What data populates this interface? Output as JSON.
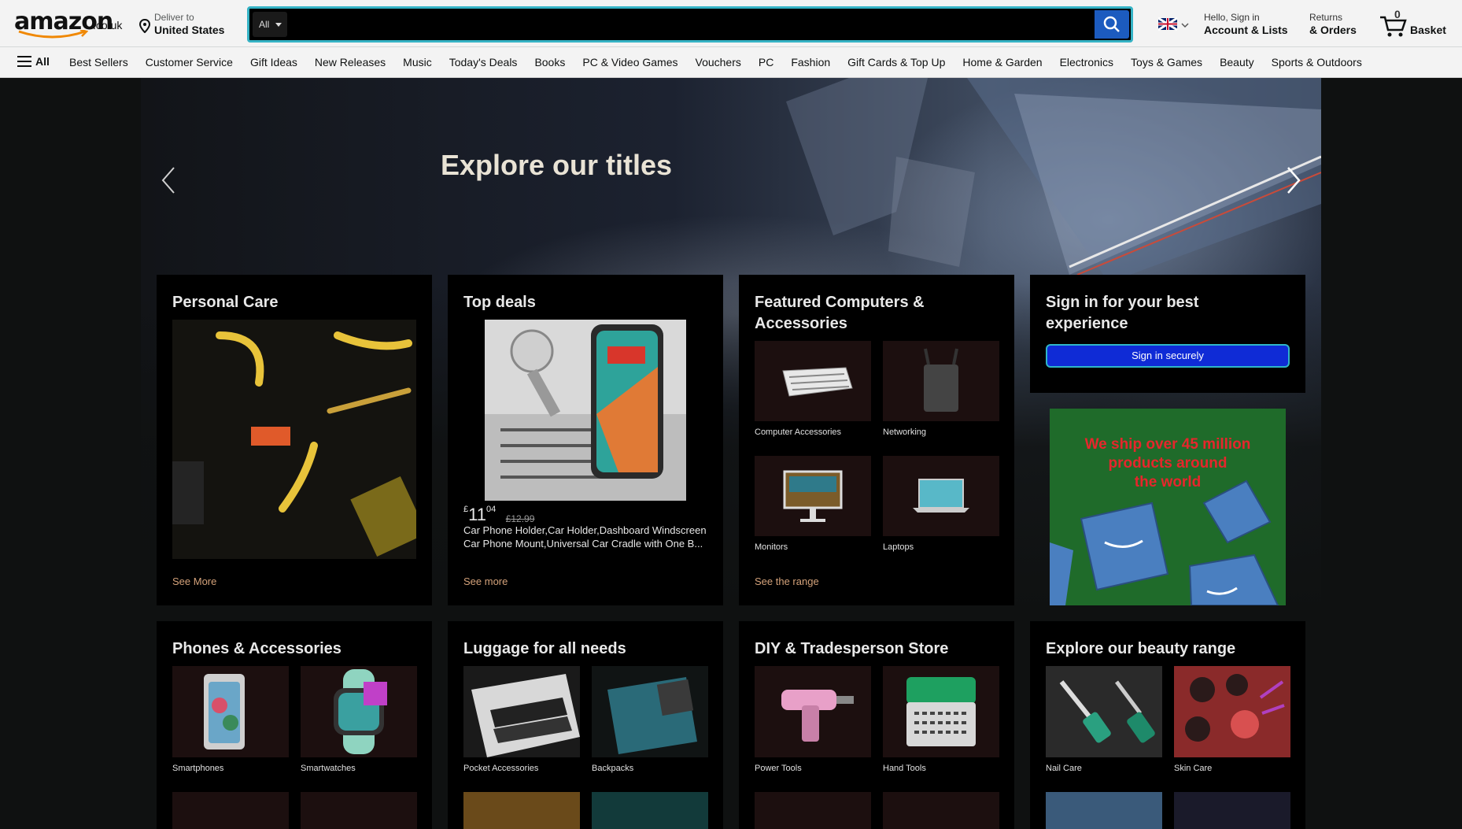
{
  "header": {
    "logo_word": "amazon",
    "logo_tld": ".co.uk",
    "deliver_to": "Deliver to",
    "deliver_location": "United States",
    "search_category": "All",
    "search_placeholder": "",
    "account_greeting": "Hello, Sign in",
    "account_label": "Account & Lists",
    "returns_l1": "Returns",
    "returns_l2": "& Orders",
    "basket_count": "0",
    "basket_label": "Basket"
  },
  "subnav": {
    "all_label": "All",
    "items": [
      "Best Sellers",
      "Customer Service",
      "Gift Ideas",
      "New Releases",
      "Music",
      "Today's Deals",
      "Books",
      "PC & Video Games",
      "Vouchers",
      "PC",
      "Fashion",
      "Gift Cards & Top Up",
      "Home & Garden",
      "Electronics",
      "Toys & Games",
      "Beauty",
      "Sports & Outdoors"
    ]
  },
  "hero": {
    "title": "Explore our titles"
  },
  "cards": {
    "personal_care": {
      "title": "Personal Care",
      "link": "See More"
    },
    "top_deals": {
      "title": "Top deals",
      "price_symbol": "£",
      "price_whole": "11",
      "price_fraction": "04",
      "price_was": "£12.99",
      "product_line1": "Car Phone Holder,Car Holder,Dashboard Windscreen",
      "product_line2": "Car Phone Mount,Universal Car Cradle with One B...",
      "link": "See more"
    },
    "computers": {
      "title_l1": "Featured Computers &",
      "title_l2": "Accessories",
      "tiles": [
        "Computer Accessories",
        "Networking",
        "Monitors",
        "Laptops"
      ],
      "link": "See the range"
    },
    "signin": {
      "title_l1": "Sign in for your best",
      "title_l2": "experience",
      "button": "Sign in securely"
    },
    "ship_ad": {
      "line1": "We ship over 45 million",
      "line2": "products around",
      "line3": "the world"
    },
    "phones": {
      "title": "Phones & Accessories",
      "tiles": [
        "Smartphones",
        "Smartwatches"
      ]
    },
    "luggage": {
      "title": "Luggage for all needs",
      "tiles": [
        "Pocket Accessories",
        "Backpacks"
      ]
    },
    "diy": {
      "title": "DIY & Tradesperson Store",
      "tiles": [
        "Power Tools",
        "Hand Tools"
      ]
    },
    "beauty": {
      "title": "Explore our beauty range",
      "tiles": [
        "Nail Care",
        "Skin Care"
      ]
    }
  },
  "colors": {
    "search_button": "#1c5bbf",
    "search_border": "#35b3c5",
    "link": "#d4a27a",
    "signin_button": "#0f2bd6"
  }
}
